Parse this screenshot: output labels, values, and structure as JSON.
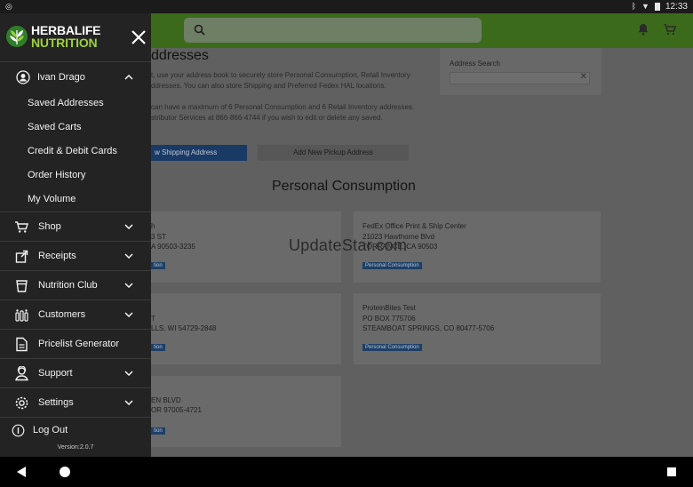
{
  "status_bar": {
    "time": "12:33"
  },
  "page": {
    "title": "ddresses",
    "intro_line1": "t, use your address book to securely store Personal Consumption, Retail Inventory",
    "intro_line2": "ddresses. You can also store Shipping and Preferred Fedex HAL locations.",
    "intro_line3": "can have a maximum of 6 Personal Consumption and 6 Retail Inventory addresses.",
    "intro_line4": "stributor Services at 866-866-4744 if you wish to edit or delete any saved.",
    "address_search_label": "Address Search",
    "add_shipping_button": "w Shipping Address",
    "add_pickup_button": "Add New Pickup Address",
    "section_title": "Personal Consumption",
    "watermark": "UpdateStar.com",
    "cards": [
      {
        "lines": [
          "h",
          "3 ST",
          "A 90503-3235"
        ],
        "badge": "tion"
      },
      {
        "lines": [
          "FedEx Office Print & Ship Center",
          "21023 Hawthorne Blvd",
          "TORRANCE, CA 90503"
        ],
        "badge": "Personal Consumption"
      },
      {
        "lines": [
          "T",
          "LLS, WI 54729-2848"
        ],
        "badge": "tion"
      },
      {
        "lines": [
          "ProteinBites Test",
          "PO BOX 775706",
          "STEAMBOAT SPRINGS, CO 80477-5706"
        ],
        "badge": "Personal Consumption"
      },
      {
        "lines": [
          "EN BLVD",
          "OR 97005-4721"
        ],
        "badge": "tion"
      }
    ]
  },
  "drawer": {
    "logo_line1": "HERBALIFE",
    "logo_line2": "NUTRITION",
    "user_name": "Ivan Drago",
    "submenu": [
      "Saved Addresses",
      "Saved Carts",
      "Credit & Debit Cards",
      "Order History",
      "My Volume"
    ],
    "menu": [
      {
        "label": "Shop",
        "icon": "cart-icon",
        "has_chevron": true
      },
      {
        "label": "Receipts",
        "icon": "receipt-icon",
        "has_chevron": true
      },
      {
        "label": "Nutrition Club",
        "icon": "cup-icon",
        "has_chevron": true
      },
      {
        "label": "Customers",
        "icon": "customers-icon",
        "has_chevron": true
      },
      {
        "label": "Pricelist Generator",
        "icon": "document-icon",
        "has_chevron": false
      },
      {
        "label": "Support",
        "icon": "support-icon",
        "has_chevron": true
      },
      {
        "label": "Settings",
        "icon": "gear-icon",
        "has_chevron": true
      }
    ],
    "logout": "Log Out",
    "version": "Version:2.0.7"
  },
  "colors": {
    "brand_green": "#3b6b1a",
    "logo_green": "#9bd13a",
    "drawer_bg": "#232323",
    "primary_blue": "#1a3a66"
  }
}
